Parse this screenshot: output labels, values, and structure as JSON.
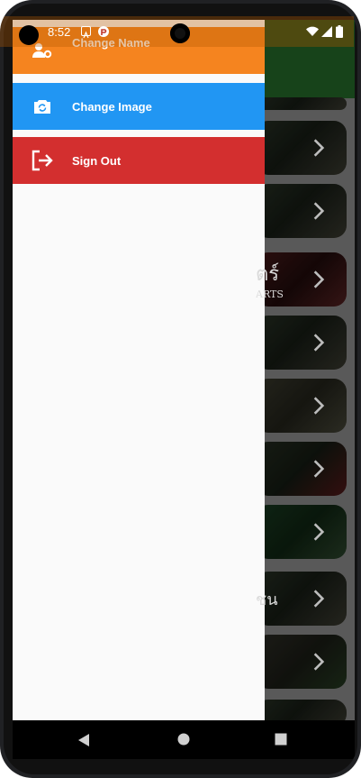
{
  "status_bar": {
    "time": "8:52",
    "notification_icons": [
      "a-badge-icon",
      "p-badge-icon"
    ],
    "right_icons": [
      "wifi-icon",
      "signal-icon",
      "battery-icon"
    ]
  },
  "drawer": {
    "items": [
      {
        "label": "Change Name",
        "color": "#f5841f",
        "icon": "user-settings-icon"
      },
      {
        "label": "Change Image",
        "color": "#2196f3",
        "icon": "camera-rotate-icon"
      },
      {
        "label": "Sign Out",
        "color": "#d32f2f",
        "icon": "sign-out-icon"
      }
    ]
  },
  "background_list": {
    "card_texts": [
      "ตร์",
      "ARTS",
      "ชน"
    ]
  },
  "colors": {
    "app_bar": "#1f5a23",
    "drawer_bg": "#fafafa"
  }
}
